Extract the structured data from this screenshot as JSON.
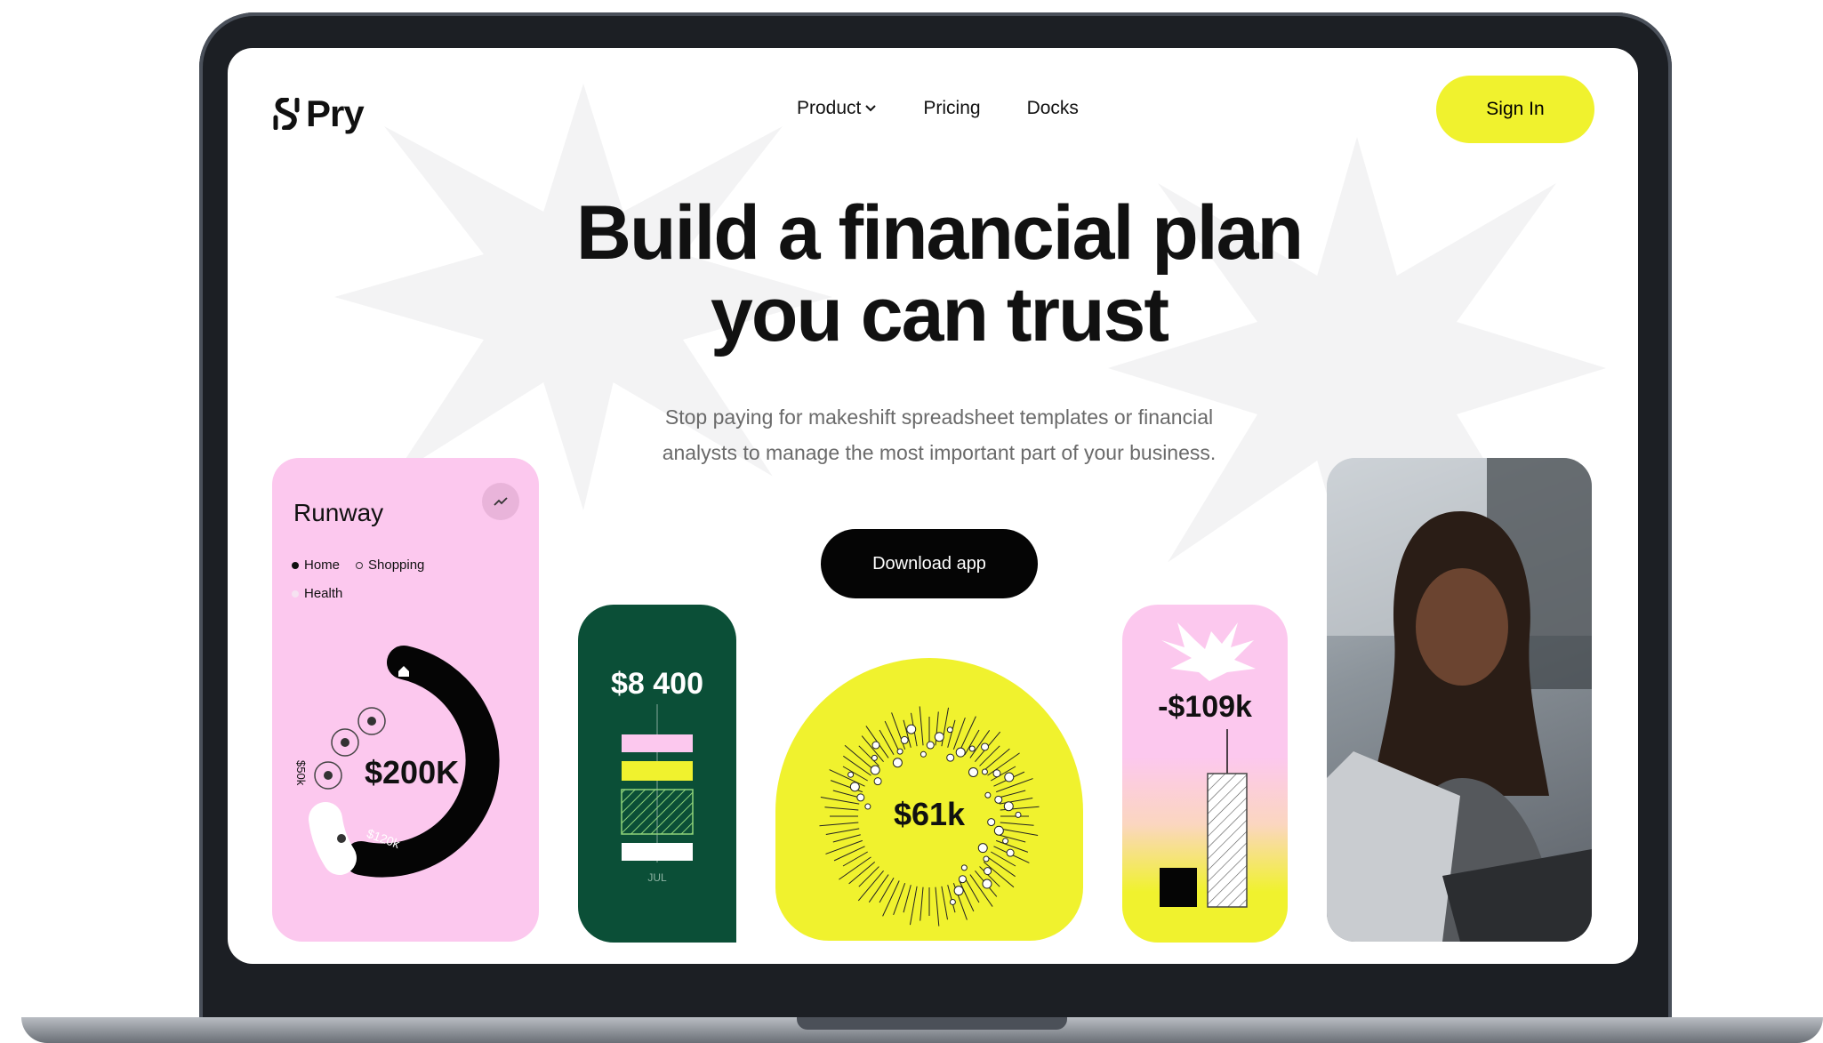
{
  "brand": {
    "name": "Pry"
  },
  "nav": {
    "items": [
      {
        "label": "Product",
        "has_dropdown": true
      },
      {
        "label": "Pricing",
        "has_dropdown": false
      },
      {
        "label": "Docks",
        "has_dropdown": false
      }
    ],
    "signin_label": "Sign In"
  },
  "hero": {
    "title_line1": "Build a financial plan",
    "title_line2": "you can trust",
    "subtitle_line1": "Stop paying for makeshift spreadsheet templates or financial",
    "subtitle_line2": "analysts to manage the most important part of your business.",
    "cta_label": "Download app"
  },
  "cards": {
    "runway": {
      "title": "Runway",
      "legend": [
        {
          "label": "Home",
          "color": "#111111"
        },
        {
          "label": "Shopping",
          "color": "#ffffff"
        },
        {
          "label": "Health",
          "color": "#f6e2f1"
        }
      ],
      "value": "$200K",
      "segment_small": "$50k",
      "segment_large": "$120k"
    },
    "expense": {
      "value": "$8 400",
      "month": "JUL"
    },
    "burst": {
      "value": "$61k"
    },
    "loss": {
      "value": "-$109k"
    }
  },
  "colors": {
    "accent_yellow": "#f0f22e",
    "pink": "#fcc8ee",
    "dark_green": "#0b4f37",
    "black": "#050505"
  },
  "icons": {
    "logo": "pry-logo-icon",
    "dropdown": "chevron-down-icon",
    "trend": "trend-up-icon"
  }
}
